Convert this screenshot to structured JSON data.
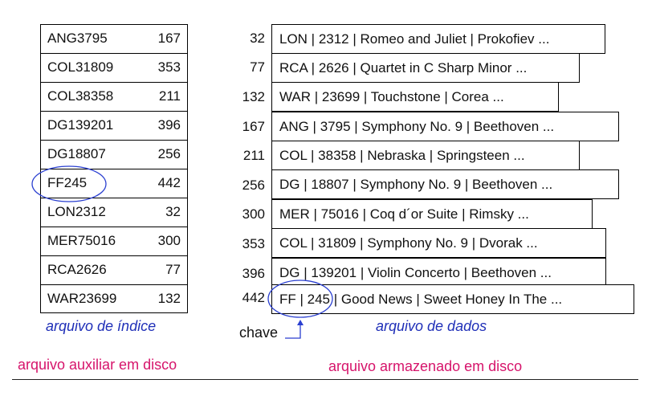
{
  "index_file": {
    "rows": [
      {
        "key": "ANG3795",
        "addr": "167"
      },
      {
        "key": "COL31809",
        "addr": "353"
      },
      {
        "key": "COL38358",
        "addr": "211"
      },
      {
        "key": "DG139201",
        "addr": "396"
      },
      {
        "key": "DG18807",
        "addr": "256"
      },
      {
        "key": "FF245",
        "addr": "442"
      },
      {
        "key": "LON2312",
        "addr": "32"
      },
      {
        "key": "MER75016",
        "addr": "300"
      },
      {
        "key": "RCA2626",
        "addr": "77"
      },
      {
        "key": "WAR23699",
        "addr": "132"
      }
    ],
    "caption": "arquivo de índice"
  },
  "data_file": {
    "rows": [
      {
        "addr": "32",
        "record": "LON | 2312 | Romeo and Juliet | Prokofiev ..."
      },
      {
        "addr": "77",
        "record": "RCA | 2626 | Quartet in C Sharp Minor ..."
      },
      {
        "addr": "132",
        "record": "WAR | 23699 | Touchstone | Corea ..."
      },
      {
        "addr": "167",
        "record": "ANG | 3795 | Symphony No. 9 | Beethoven ..."
      },
      {
        "addr": "211",
        "record": "COL | 38358 | Nebraska | Springsteen ..."
      },
      {
        "addr": "256",
        "record": "DG | 18807 | Symphony No. 9 | Beethoven ..."
      },
      {
        "addr": "300",
        "record": "MER | 75016 | Coq d´or Suite | Rimsky ..."
      },
      {
        "addr": "353",
        "record": "COL | 31809 | Symphony No. 9 | Dvorak ..."
      },
      {
        "addr": "396",
        "record": "DG | 139201 | Violin Concerto | Beethoven ..."
      },
      {
        "addr": "442",
        "record": "FF | 245 | Good News | Sweet Honey In The ..."
      }
    ],
    "caption": "arquivo de dados"
  },
  "key_label": "chave",
  "footer": {
    "left": "arquivo auxiliar em disco",
    "right": "arquivo armazenado em disco"
  },
  "colors": {
    "caption_blue": "#1f2fb8",
    "footer_pink": "#d6146b",
    "highlight_circle": "#2a3fd0"
  }
}
